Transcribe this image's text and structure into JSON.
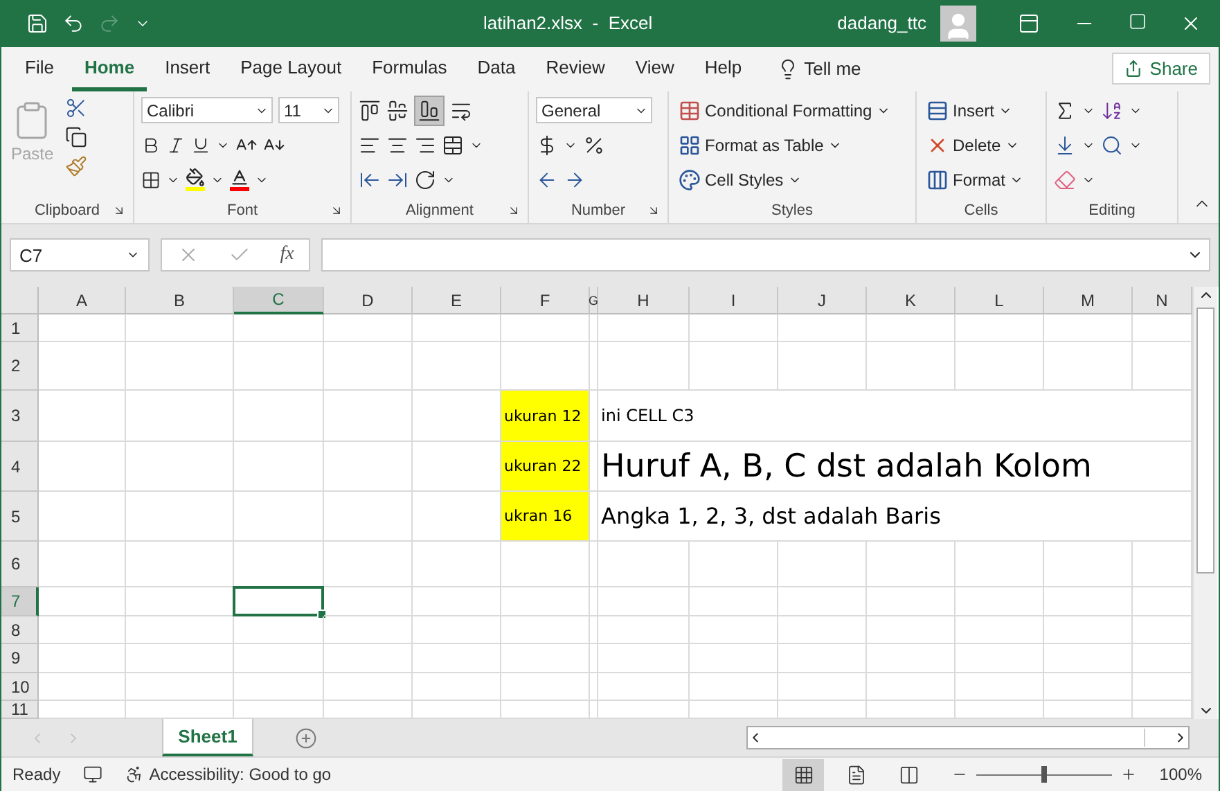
{
  "title_bar": {
    "title": "latihan2.xlsx  -  Excel",
    "user": "dadang_ttc",
    "redo_disabled": true
  },
  "menu_tabs": [
    {
      "label": "File",
      "selected": false
    },
    {
      "label": "Home",
      "selected": true
    },
    {
      "label": "Insert",
      "selected": false
    },
    {
      "label": "Page Layout",
      "selected": false
    },
    {
      "label": "Formulas",
      "selected": false
    },
    {
      "label": "Data",
      "selected": false
    },
    {
      "label": "Review",
      "selected": false
    },
    {
      "label": "View",
      "selected": false
    },
    {
      "label": "Help",
      "selected": false
    }
  ],
  "tell_me": "Tell me",
  "share": "Share",
  "ribbon": {
    "paste_label": "Paste",
    "paste_disabled": true,
    "font_name": "Calibri",
    "font_size": "11",
    "bottom_align_on": true,
    "number_format": "General",
    "styles": [
      "Conditional Formatting",
      "Format as Table",
      "Cell Styles"
    ],
    "cells": [
      "Insert",
      "Delete",
      "Format"
    ],
    "groups": [
      "Clipboard",
      "Font",
      "Alignment",
      "Number",
      "Styles",
      "Cells",
      "Editing"
    ]
  },
  "formula_bar": {
    "name_box": "C7",
    "function_label": "fx"
  },
  "sheet": {
    "columns": [
      {
        "label": "A",
        "selected": false
      },
      {
        "label": "B",
        "selected": false
      },
      {
        "label": "C",
        "selected": true
      },
      {
        "label": "D",
        "selected": false
      },
      {
        "label": "E",
        "selected": false
      },
      {
        "label": "F",
        "selected": false
      },
      {
        "label": "G",
        "selected": false
      },
      {
        "label": "H",
        "selected": false
      },
      {
        "label": "I",
        "selected": false
      },
      {
        "label": "J",
        "selected": false
      },
      {
        "label": "K",
        "selected": false
      },
      {
        "label": "L",
        "selected": false
      },
      {
        "label": "M",
        "selected": false
      },
      {
        "label": "N",
        "selected": false
      }
    ],
    "rows": [
      {
        "label": "1",
        "selected": false
      },
      {
        "label": "2",
        "selected": false
      },
      {
        "label": "3",
        "selected": false,
        "entries": [
          {
            "kind": "label",
            "text": "ukuran 12",
            "highlighted": true
          },
          {
            "kind": "note",
            "text": "ini CELL C3"
          }
        ]
      },
      {
        "label": "4",
        "selected": false,
        "entries": [
          {
            "kind": "label",
            "text": "ukuran 22",
            "highlighted": true
          },
          {
            "kind": "heading",
            "text": "Huruf A, B, C dst adalah Kolom"
          }
        ]
      },
      {
        "label": "5",
        "selected": false,
        "entries": [
          {
            "kind": "label",
            "text": "ukran 16",
            "highlighted": true
          },
          {
            "kind": "subheading",
            "text": "Angka 1, 2, 3, dst adalah Baris"
          }
        ]
      },
      {
        "label": "6",
        "selected": false
      },
      {
        "label": "7",
        "selected": true
      },
      {
        "label": "8",
        "selected": false
      },
      {
        "label": "9",
        "selected": false
      },
      {
        "label": "10",
        "selected": false
      },
      {
        "label": "11",
        "selected": false
      }
    ]
  },
  "sheet_tabs": [
    {
      "label": "Sheet1",
      "selected": true
    }
  ],
  "status_bar": {
    "mode": "Ready",
    "accessibility": "Accessibility: Good to go",
    "views": [
      {
        "kind": "normal",
        "selected": true
      },
      {
        "kind": "page_layout",
        "selected": false
      },
      {
        "kind": "page_break",
        "selected": false
      }
    ],
    "zoom": {
      "level": 0.5,
      "reading": "100%"
    }
  }
}
